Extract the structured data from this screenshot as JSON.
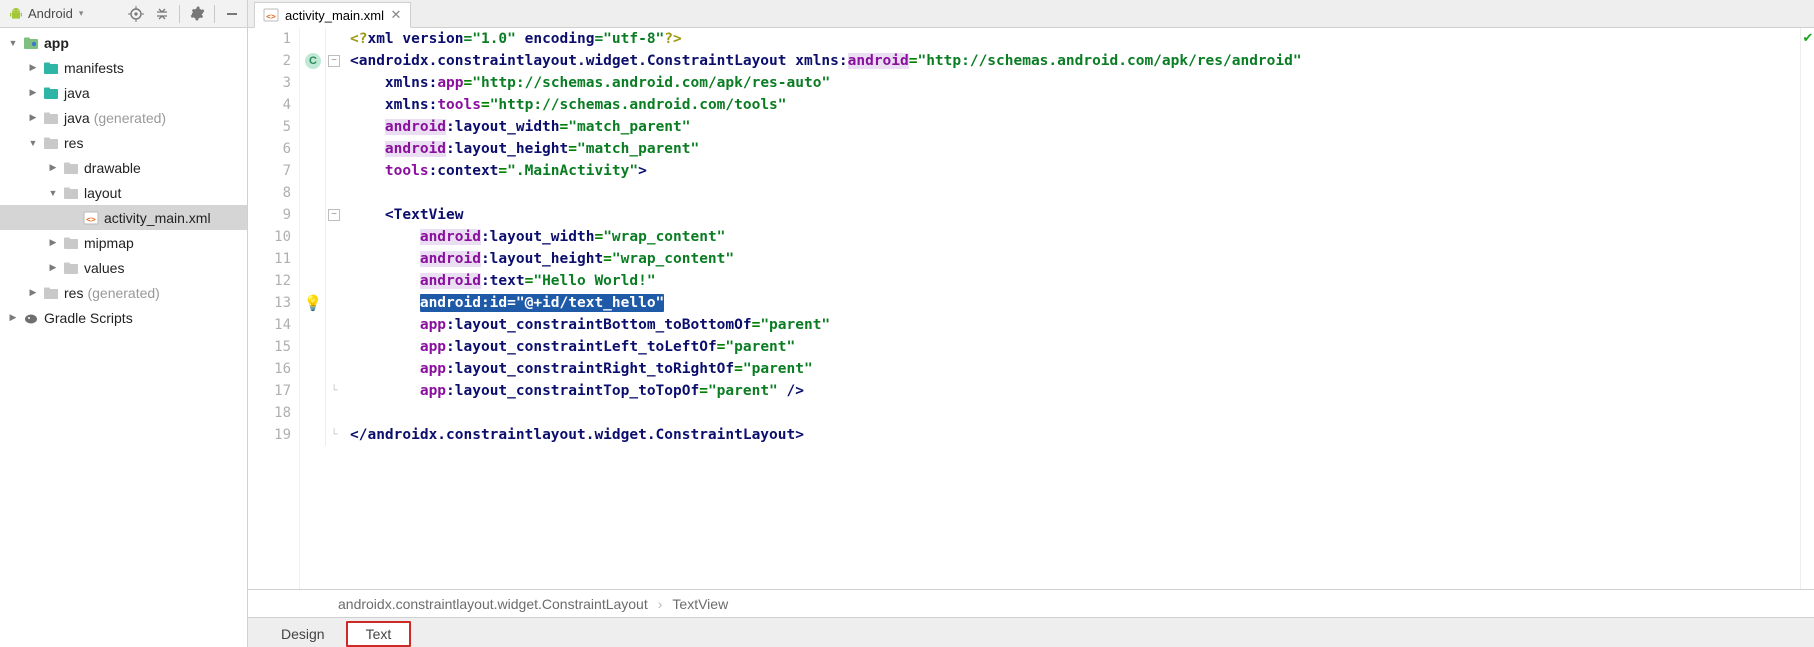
{
  "sidebar": {
    "title": "Android",
    "tree": [
      {
        "depth": 0,
        "expander": "down",
        "kind": "module",
        "label": "app",
        "bold": true
      },
      {
        "depth": 1,
        "expander": "right",
        "kind": "folder-teal",
        "label": "manifests"
      },
      {
        "depth": 1,
        "expander": "right",
        "kind": "folder-teal",
        "label": "java"
      },
      {
        "depth": 1,
        "expander": "right",
        "kind": "folder-gray",
        "label": "java",
        "suffix": "(generated)"
      },
      {
        "depth": 1,
        "expander": "down",
        "kind": "folder-gray",
        "label": "res"
      },
      {
        "depth": 2,
        "expander": "right",
        "kind": "folder-gray",
        "label": "drawable"
      },
      {
        "depth": 2,
        "expander": "down",
        "kind": "folder-gray",
        "label": "layout"
      },
      {
        "depth": 3,
        "expander": "none",
        "kind": "xml",
        "label": "activity_main.xml",
        "selected": true
      },
      {
        "depth": 2,
        "expander": "right",
        "kind": "folder-gray",
        "label": "mipmap"
      },
      {
        "depth": 2,
        "expander": "right",
        "kind": "folder-gray",
        "label": "values"
      },
      {
        "depth": 1,
        "expander": "right",
        "kind": "folder-gray",
        "label": "res",
        "suffix": "(generated)"
      },
      {
        "depth": 0,
        "expander": "right",
        "kind": "gradle",
        "label": "Gradle Scripts"
      }
    ]
  },
  "tab": {
    "filename": "activity_main.xml"
  },
  "breadcrumb": {
    "items": [
      "androidx.constraintlayout.widget.ConstraintLayout",
      "TextView"
    ]
  },
  "bottom_tabs": {
    "design": "Design",
    "text": "Text"
  },
  "code": {
    "lines": [
      [
        {
          "t": "<?",
          "c": "pi"
        },
        {
          "t": "xml version",
          "c": "attr"
        },
        {
          "t": "=\"1.0\" ",
          "c": "val"
        },
        {
          "t": "encoding",
          "c": "attr"
        },
        {
          "t": "=\"utf-8\"",
          "c": "val"
        },
        {
          "t": "?>",
          "c": "pi"
        }
      ],
      [
        {
          "t": "<",
          "c": "tag"
        },
        {
          "t": "androidx.constraintlayout.widget.ConstraintLayout ",
          "c": "tag"
        },
        {
          "t": "xmlns:",
          "c": "attr"
        },
        {
          "t": "android",
          "c": "ns",
          "bg": "purple"
        },
        {
          "t": "=",
          "c": "op"
        },
        {
          "t": "\"http://schemas.android.com/apk/res/android\"",
          "c": "val"
        }
      ],
      [
        {
          "t": "    "
        },
        {
          "t": "xmlns:",
          "c": "attr"
        },
        {
          "t": "app",
          "c": "ns"
        },
        {
          "t": "=",
          "c": "op"
        },
        {
          "t": "\"http://schemas.android.com/apk/res-auto\"",
          "c": "val"
        }
      ],
      [
        {
          "t": "    "
        },
        {
          "t": "xmlns:",
          "c": "attr"
        },
        {
          "t": "tools",
          "c": "ns"
        },
        {
          "t": "=",
          "c": "op"
        },
        {
          "t": "\"http://schemas.android.com/tools\"",
          "c": "val"
        }
      ],
      [
        {
          "t": "    "
        },
        {
          "t": "android",
          "c": "ns",
          "bg": "purple"
        },
        {
          "t": ":layout_width",
          "c": "attr"
        },
        {
          "t": "=",
          "c": "op"
        },
        {
          "t": "\"match_parent\"",
          "c": "val"
        }
      ],
      [
        {
          "t": "    "
        },
        {
          "t": "android",
          "c": "ns",
          "bg": "purple"
        },
        {
          "t": ":layout_height",
          "c": "attr"
        },
        {
          "t": "=",
          "c": "op"
        },
        {
          "t": "\"match_parent\"",
          "c": "val"
        }
      ],
      [
        {
          "t": "    "
        },
        {
          "t": "tools",
          "c": "ns"
        },
        {
          "t": ":context",
          "c": "attr"
        },
        {
          "t": "=",
          "c": "op"
        },
        {
          "t": "\".MainActivity\"",
          "c": "val"
        },
        {
          "t": ">",
          "c": "tag"
        }
      ],
      [
        {
          "t": " "
        }
      ],
      [
        {
          "t": "    <",
          "c": "tag"
        },
        {
          "t": "TextView",
          "c": "tag"
        }
      ],
      [
        {
          "t": "        "
        },
        {
          "t": "android",
          "c": "ns",
          "bg": "purple"
        },
        {
          "t": ":layout_width",
          "c": "attr"
        },
        {
          "t": "=",
          "c": "op"
        },
        {
          "t": "\"wrap_content\"",
          "c": "val"
        }
      ],
      [
        {
          "t": "        "
        },
        {
          "t": "android",
          "c": "ns",
          "bg": "purple"
        },
        {
          "t": ":layout_height",
          "c": "attr"
        },
        {
          "t": "=",
          "c": "op"
        },
        {
          "t": "\"wrap_content\"",
          "c": "val"
        }
      ],
      [
        {
          "t": "        "
        },
        {
          "t": "android",
          "c": "ns",
          "bg": "purple"
        },
        {
          "t": ":text",
          "c": "attr"
        },
        {
          "t": "=",
          "c": "op"
        },
        {
          "t": "\"Hello World!\"",
          "c": "val"
        }
      ],
      [
        {
          "t": "        "
        },
        {
          "t": "android:id=\"@+id/text_hello\"",
          "sel": true
        }
      ],
      [
        {
          "t": "        "
        },
        {
          "t": "app",
          "c": "ns"
        },
        {
          "t": ":layout_constraintBottom_toBottomOf",
          "c": "attr"
        },
        {
          "t": "=",
          "c": "op"
        },
        {
          "t": "\"parent\"",
          "c": "val"
        }
      ],
      [
        {
          "t": "        "
        },
        {
          "t": "app",
          "c": "ns"
        },
        {
          "t": ":layout_constraintLeft_toLeftOf",
          "c": "attr"
        },
        {
          "t": "=",
          "c": "op"
        },
        {
          "t": "\"parent\"",
          "c": "val"
        }
      ],
      [
        {
          "t": "        "
        },
        {
          "t": "app",
          "c": "ns"
        },
        {
          "t": ":layout_constraintRight_toRightOf",
          "c": "attr"
        },
        {
          "t": "=",
          "c": "op"
        },
        {
          "t": "\"parent\"",
          "c": "val"
        }
      ],
      [
        {
          "t": "        "
        },
        {
          "t": "app",
          "c": "ns"
        },
        {
          "t": ":layout_constraintTop_toTopOf",
          "c": "attr"
        },
        {
          "t": "=",
          "c": "op"
        },
        {
          "t": "\"parent\" ",
          "c": "val"
        },
        {
          "t": "/>",
          "c": "tag"
        }
      ],
      [
        {
          "t": " "
        }
      ],
      [
        {
          "t": "</",
          "c": "tag"
        },
        {
          "t": "androidx.constraintlayout.widget.ConstraintLayout",
          "c": "tag"
        },
        {
          "t": ">",
          "c": "tag"
        }
      ]
    ],
    "highlight_line": 13,
    "annotations": {
      "2": "circle-c",
      "13": "bulb"
    },
    "folds": {
      "2": "minus",
      "9": "minus",
      "17": "end",
      "19": "end"
    }
  }
}
